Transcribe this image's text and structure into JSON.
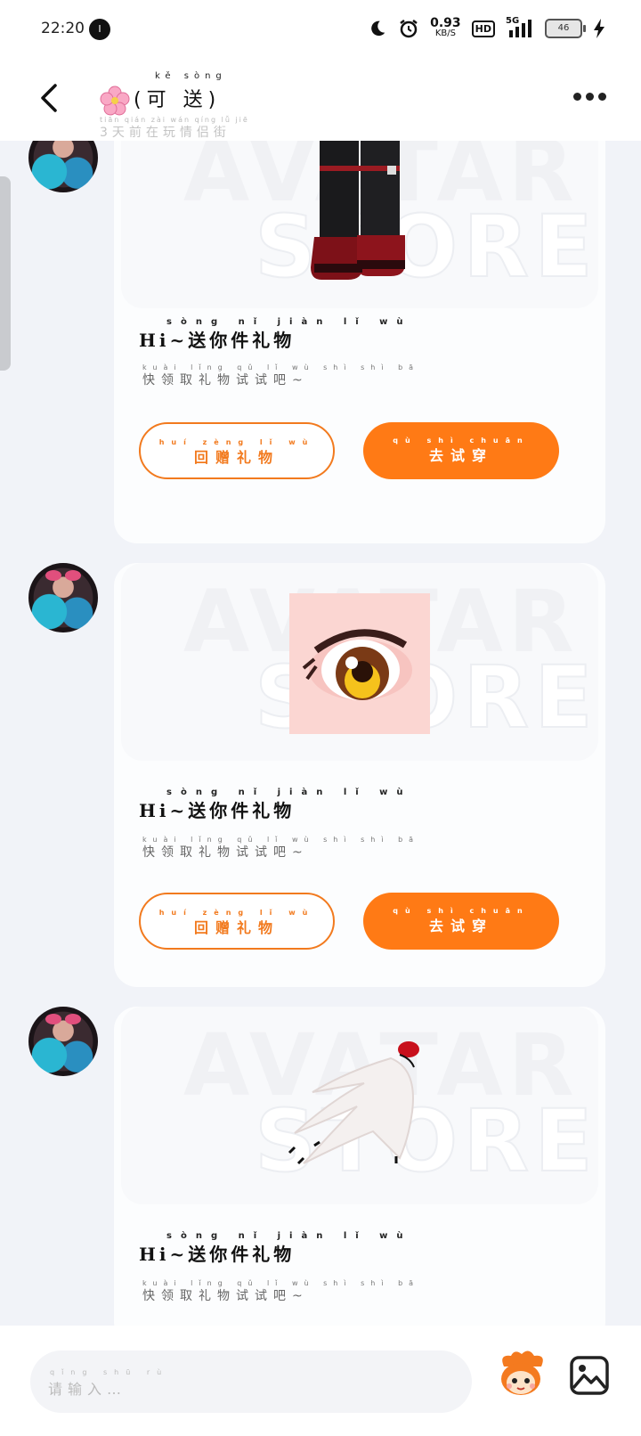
{
  "status_bar": {
    "time": "22:20",
    "notif_badge": "I",
    "net_speed": "0.93",
    "net_unit": "KB/S",
    "hd": "HD",
    "signal": "5G",
    "battery": "46"
  },
  "header": {
    "title_pinyin": "kě sòng",
    "title": "(可 送)",
    "subtitle_pinyin": "tiān qián zài wán qíng lǚ jiē",
    "subtitle": "3天前在玩情侣街"
  },
  "watermark": {
    "line1": "AVATAR",
    "line2": "STORE"
  },
  "messages": [
    {
      "item": "boots-icon",
      "title_pinyin": "sòng nǐ jiàn lǐ wù",
      "title": "Hi~送你件礼物",
      "desc_pinyin": "kuài lǐng qǔ lǐ wù shì shì bā",
      "desc": "快领取礼物试试吧~",
      "btn_return_pinyin": "huí zèng lǐ wù",
      "btn_return": "回赠礼物",
      "btn_try_pinyin": "qù shì chuān",
      "btn_try": "去试穿"
    },
    {
      "item": "eye-icon",
      "title_pinyin": "sòng nǐ jiàn lǐ wù",
      "title": "Hi~送你件礼物",
      "desc_pinyin": "kuài lǐng qǔ lǐ wù shì shì bā",
      "desc": "快领取礼物试试吧~",
      "btn_return_pinyin": "huí zèng lǐ wù",
      "btn_return": "回赠礼物",
      "btn_try_pinyin": "qù shì chuān",
      "btn_try": "去试穿"
    },
    {
      "item": "glove-icon",
      "title_pinyin": "sòng nǐ jiàn lǐ wù",
      "title": "Hi~送你件礼物",
      "desc_pinyin": "kuài lǐng qǔ lǐ wù shì shì bā",
      "desc": "快领取礼物试试吧~"
    }
  ],
  "input": {
    "placeholder_pinyin": "qǐng shū rù",
    "placeholder": "请输入…"
  },
  "colors": {
    "accent": "#ff7a15",
    "background": "#f1f3f8"
  }
}
